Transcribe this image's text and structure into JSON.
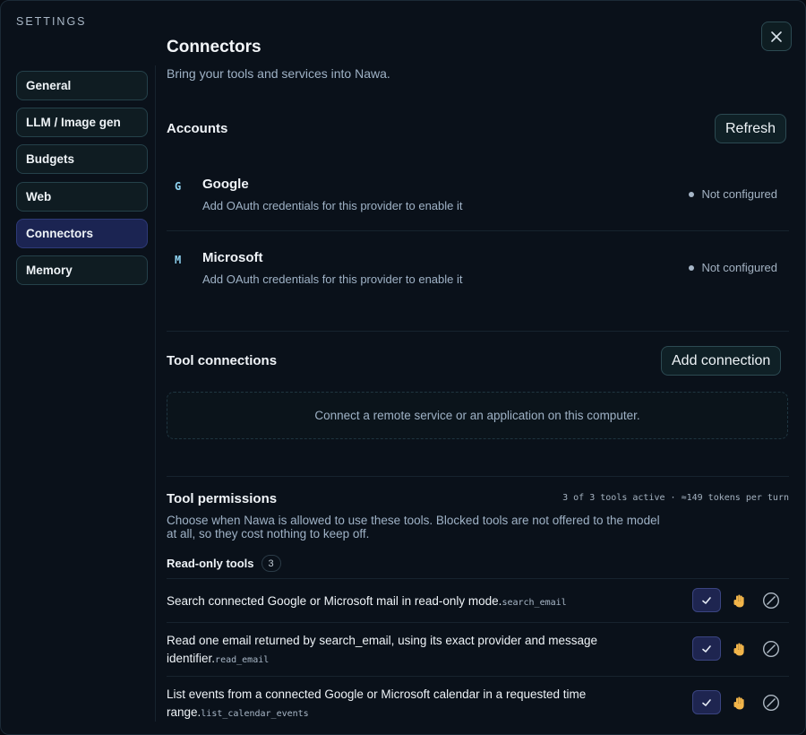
{
  "sidebar": {
    "title": "SETTINGS",
    "items": [
      {
        "label": "General"
      },
      {
        "label": "LLM / Image gen"
      },
      {
        "label": "Budgets"
      },
      {
        "label": "Web"
      },
      {
        "label": "Connectors"
      },
      {
        "label": "Memory"
      }
    ],
    "active": "Connectors"
  },
  "page": {
    "title": "Connectors",
    "subtitle": "Bring your tools and services into Nawa."
  },
  "accounts": {
    "heading": "Accounts",
    "refresh_label": "Refresh",
    "items": [
      {
        "logo": "G",
        "name": "Google",
        "description": "Add OAuth credentials for this provider to enable it",
        "status": "Not configured"
      },
      {
        "logo": "M",
        "name": "Microsoft",
        "description": "Add OAuth credentials for this provider to enable it",
        "status": "Not configured"
      }
    ]
  },
  "tool_connections": {
    "heading": "Tool connections",
    "add_label": "Add connection",
    "empty_text": "Connect a remote service or an application on this computer."
  },
  "tool_permissions": {
    "heading": "Tool permissions",
    "stats": "3 of 3 tools active · ≈149 tokens per turn",
    "description": "Choose when Nawa is allowed to use these tools. Blocked tools are not offered to the model at all, so they cost nothing to keep off.",
    "group_label": "Read-only tools",
    "group_count": "3",
    "tools": [
      {
        "description": "Search connected Google or Microsoft mail in read-only mode.",
        "code": "search_email",
        "permission": "allow"
      },
      {
        "description": "Read one email returned by search_email, using its exact provider and message identifier.",
        "code": "read_email",
        "permission": "allow"
      },
      {
        "description": "List events from a connected Google or Microsoft calendar in a requested time range.",
        "code": "list_calendar_events",
        "permission": "allow"
      }
    ]
  },
  "icons": {
    "close": "close-icon",
    "allow": "check-icon",
    "ask": "hand-icon",
    "block": "block-icon"
  },
  "colors": {
    "background": "#0a111a",
    "active_nav": "#1b2452",
    "accent_code": "#8fd4f2"
  }
}
